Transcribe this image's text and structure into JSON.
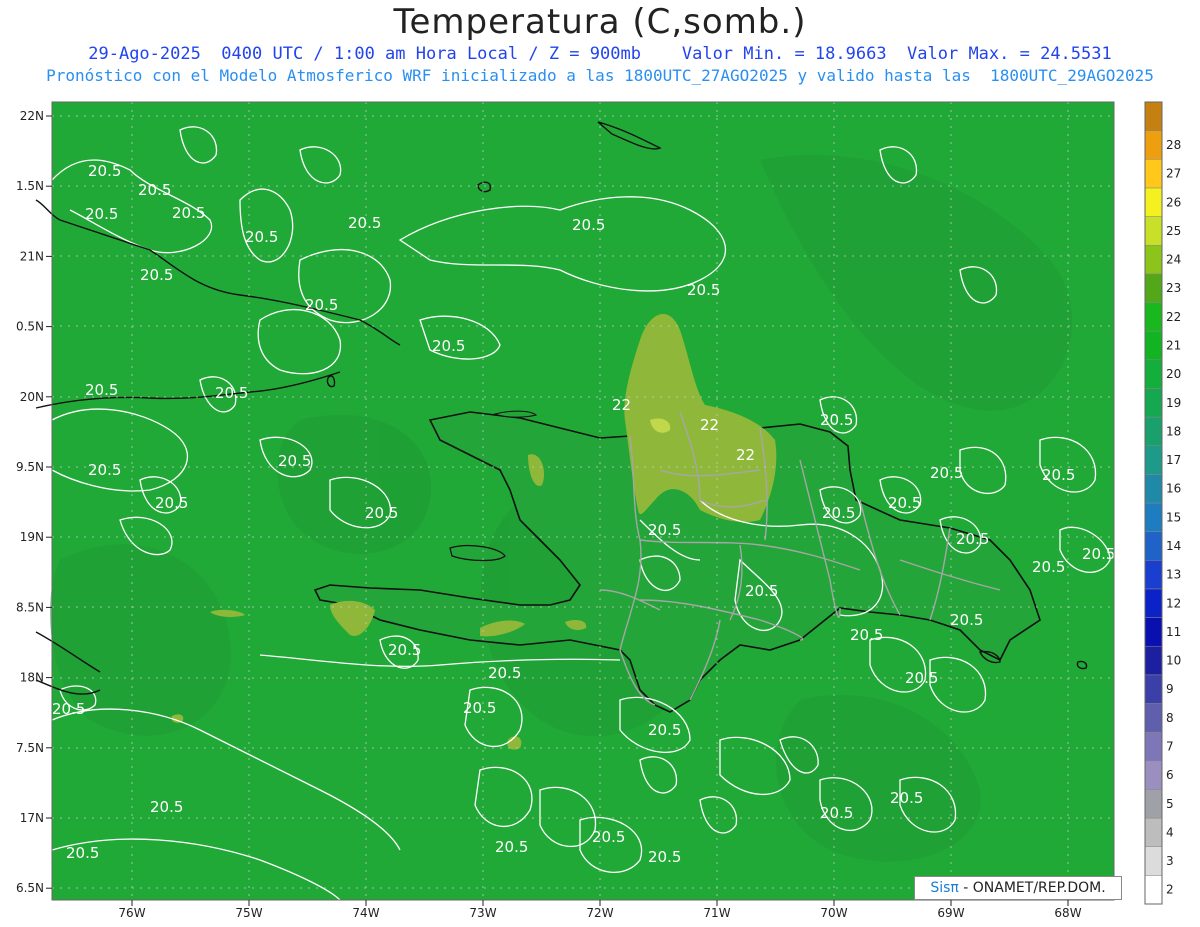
{
  "title": "Temperatura (C,somb.)",
  "subtitle1": "29-Ago-2025  0400 UTC / 1:00 am Hora Local / Z = 900mb    Valor Min. = 18.9663  Valor Max. = 24.5531",
  "subtitle2": "Pronóstico con el Modelo Atmosferico WRF inicializado a las 1800UTC_27AGO2025 y valido hasta las  1800UTC_29AGO2025",
  "credit": {
    "brand": "Sisπ",
    "text": " - ONAMET/REP.DOM."
  },
  "lat_labels": [
    "22N",
    "1.5N",
    "21N",
    "0.5N",
    "20N",
    "9.5N",
    "19N",
    "8.5N",
    "18N",
    "7.5N",
    "17N",
    "6.5N"
  ],
  "lon_labels": [
    "76W",
    "75W",
    "74W",
    "73W",
    "72W",
    "71W",
    "70W",
    "69W",
    "68W"
  ],
  "colorbar": {
    "levels": [
      "2",
      "3",
      "4",
      "5",
      "6",
      "7",
      "8",
      "9",
      "10",
      "11",
      "12",
      "13",
      "14",
      "15",
      "16",
      "17",
      "18",
      "19",
      "20",
      "21",
      "22",
      "23",
      "24",
      "25",
      "26",
      "27",
      "28"
    ],
    "colors": [
      "#ffffff",
      "#dcdcdc",
      "#bdbdbd",
      "#a0a0a8",
      "#9b8fc0",
      "#7f76b8",
      "#5f5fae",
      "#3a40a8",
      "#1b1fa0",
      "#0a10b0",
      "#0a22c8",
      "#1a3fd0",
      "#1f62c8",
      "#1e7cc0",
      "#1f8aa8",
      "#1e9a8a",
      "#1aa06c",
      "#16a850",
      "#14ae3c",
      "#12b424",
      "#19b81e",
      "#52a818",
      "#8cc41c",
      "#c8e028",
      "#f5f020",
      "#ffc81a",
      "#ee9f10",
      "#c48010"
    ]
  },
  "contour_labels": [
    "20.5",
    "22"
  ],
  "colors": {
    "field": "#21a937",
    "land_field": "#2a9e3a",
    "warm": "#8fb83a",
    "contour": "#ffffff",
    "coast": "#111111",
    "border": "#a0a0a0"
  }
}
